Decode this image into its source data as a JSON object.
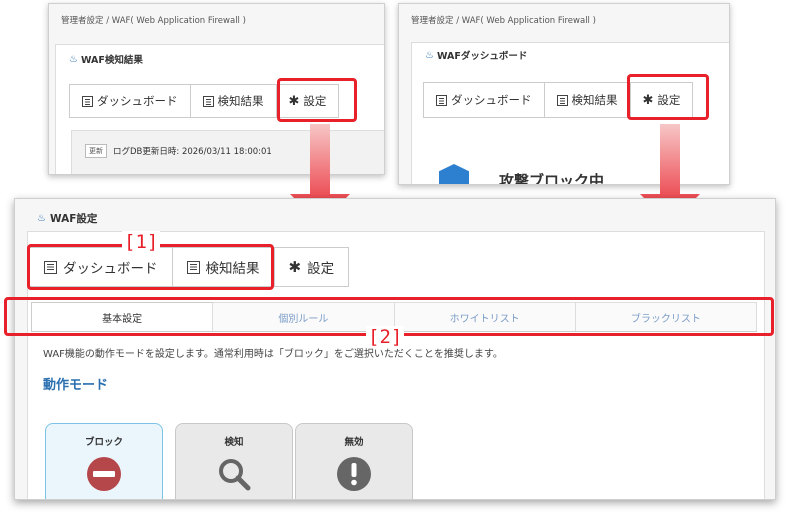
{
  "top_left": {
    "breadcrumb": "管理者設定 / WAF( Web Application Firewall )",
    "section_title": "WAF検知結果",
    "tabs": [
      "ダッシュボード",
      "検知結果",
      "設定"
    ],
    "update_tag": "更新",
    "log_text": "ログDB更新日時: 2026/03/11 18:00:01"
  },
  "top_right": {
    "breadcrumb": "管理者設定 / WAF( Web Application Firewall )",
    "section_title": "WAFダッシュボード",
    "tabs": [
      "ダッシュボード",
      "検知結果",
      "設定"
    ],
    "status_text": "攻撃ブロック中"
  },
  "main": {
    "title": "WAF設定",
    "tabs": [
      "ダッシュボード",
      "検知結果",
      "設定"
    ],
    "subtabs": [
      "基本設定",
      "個別ルール",
      "ホワイトリスト",
      "ブラックリスト"
    ],
    "label_1": "[1]",
    "label_2": "[2]",
    "description": "WAF機能の動作モードを設定します。通常利用時は「ブロック」をご選択いただくことを推奨します。",
    "mode_heading": "動作モード",
    "modes": [
      "ブロック",
      "検知",
      "無効"
    ]
  },
  "colors": {
    "highlight_red": "#e8202a",
    "accent_blue": "#2a6fb0",
    "block_red": "#b5474b",
    "grey_icon": "#666666"
  },
  "icons": [
    "list-icon",
    "gear-icon",
    "flame-icon",
    "no-entry-icon",
    "magnifier-icon",
    "exclamation-icon",
    "shield-icon"
  ]
}
